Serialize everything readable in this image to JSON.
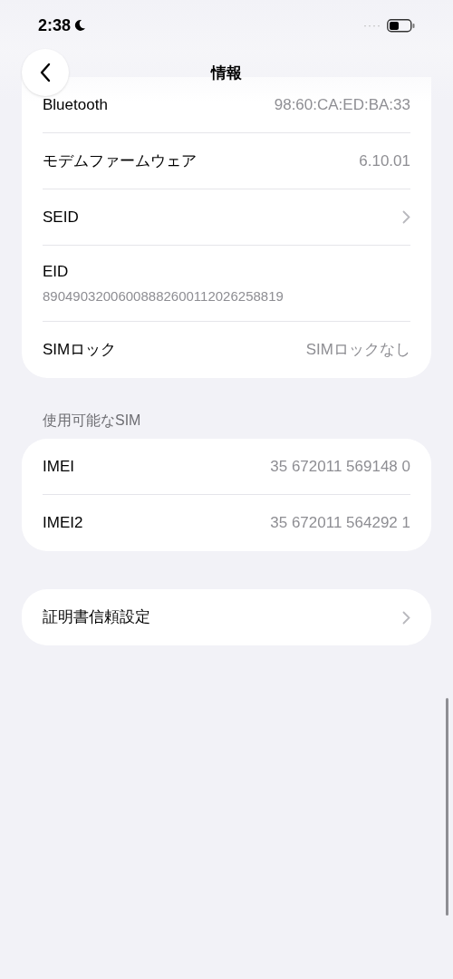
{
  "status_bar": {
    "time": "2:38",
    "signal_dots": "····"
  },
  "header": {
    "title": "情報"
  },
  "groups": [
    {
      "rows": [
        {
          "kind": "value",
          "label": "Bluetooth",
          "value": "98:60:CA:ED:BA:33"
        },
        {
          "kind": "value",
          "label": "モデムファームウェア",
          "value": "6.10.01"
        },
        {
          "kind": "link",
          "label": "SEID"
        },
        {
          "kind": "stacked",
          "label": "EID",
          "value": "89049032006008882600112026258819"
        },
        {
          "kind": "value",
          "label": "SIMロック",
          "value": "SIMロックなし"
        }
      ]
    },
    {
      "header": "使用可能なSIM",
      "rows": [
        {
          "kind": "value",
          "label": "IMEI",
          "value": "35 672011 569148 0"
        },
        {
          "kind": "value",
          "label": "IMEI2",
          "value": "35 672011 564292 1"
        }
      ]
    },
    {
      "rows": [
        {
          "kind": "link",
          "label": "証明書信頼設定"
        }
      ]
    }
  ]
}
